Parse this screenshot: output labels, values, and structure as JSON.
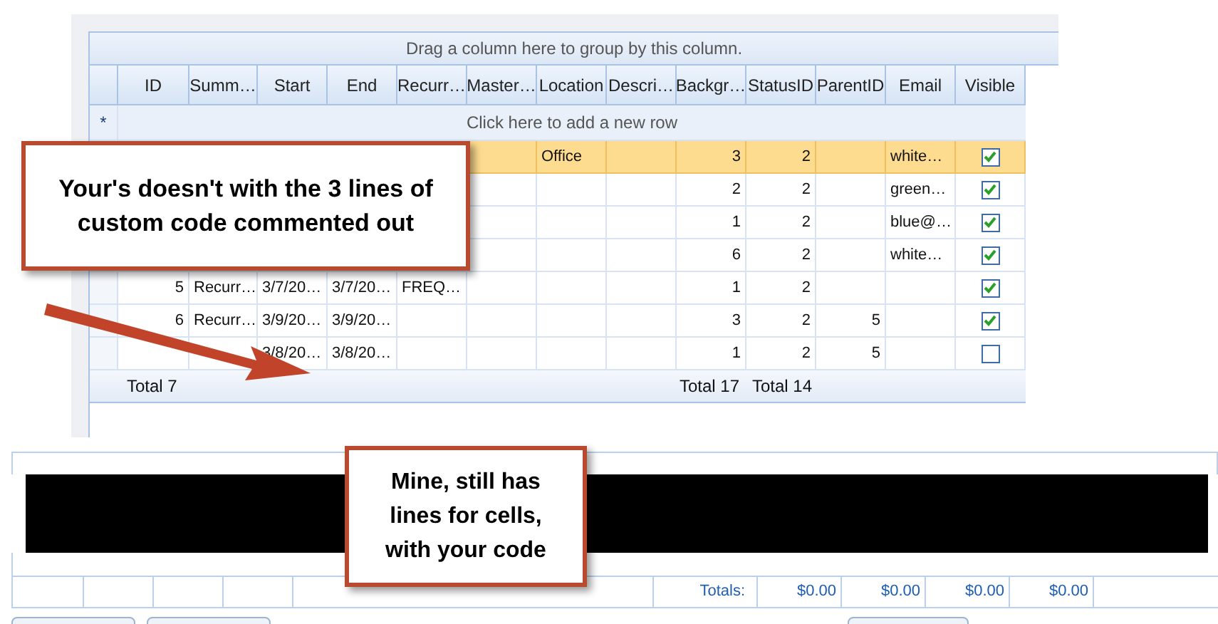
{
  "grid": {
    "group_panel": "Drag a column here to group by this column.",
    "columns": [
      "ID",
      "Summ…",
      "Start",
      "End",
      "Recurr…",
      "Master…",
      "Location",
      "Descri…",
      "Backgr…",
      "StatusID",
      "ParentID",
      "Email",
      "Visible"
    ],
    "new_row_marker": "*",
    "new_row": "Click here to add a new row",
    "rows": [
      {
        "selected": true,
        "location": "Office",
        "background": "3",
        "status_id": "2",
        "email": "white…",
        "visible": true
      },
      {
        "selected": false,
        "background": "2",
        "status_id": "2",
        "email": "green…",
        "visible": true
      },
      {
        "selected": false,
        "background": "1",
        "status_id": "2",
        "email": "blue@…",
        "visible": true
      },
      {
        "selected": false,
        "background": "6",
        "status_id": "2",
        "email": "white…",
        "visible": true
      },
      {
        "selected": false,
        "id": "5",
        "summary": "Recurr…",
        "start": "3/7/20…",
        "end": "3/7/20…",
        "recurrence": "FREQ…",
        "background": "1",
        "status_id": "2",
        "visible": true
      },
      {
        "selected": false,
        "id": "6",
        "summary": "Recurr…",
        "start": "3/9/20…",
        "end": "3/9/20…",
        "background": "3",
        "status_id": "2",
        "parent_id": "5",
        "visible": true
      },
      {
        "selected": false,
        "start": "3/8/20…",
        "end": "3/8/20…",
        "background": "1",
        "status_id": "2",
        "parent_id": "5",
        "visible": false
      }
    ],
    "footer": {
      "id": "Total 7",
      "background": "Total 17",
      "status_id": "Total 14"
    }
  },
  "callout_top": "Your's doesn't with the 3 lines of custom code commented out",
  "callout_bottom": "Mine, still has lines for cells, with your code",
  "bottom_grid": {
    "totals_label": "Totals:",
    "totals": [
      "$0.00",
      "$0.00",
      "$0.00",
      "$0.00"
    ]
  }
}
